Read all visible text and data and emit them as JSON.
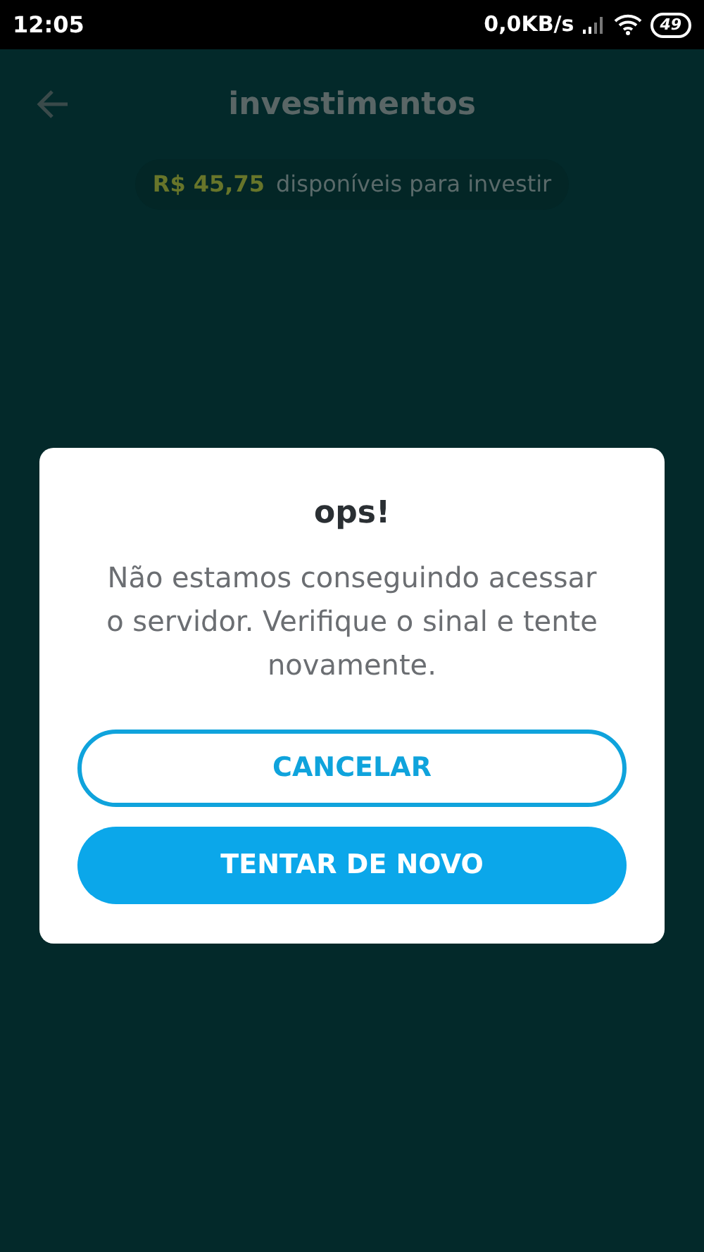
{
  "status_bar": {
    "time": "12:05",
    "speed": "0,0KB/s",
    "battery": "49"
  },
  "header": {
    "title": "investimentos"
  },
  "balance": {
    "amount": "R$ 45,75",
    "label": "disponíveis para investir"
  },
  "dialog": {
    "title": "ops!",
    "message": "Não estamos conseguindo acessar o servidor. Verifique o sinal e tente novamente.",
    "buttons": [
      {
        "label": "CANCELAR",
        "kind": "outline"
      },
      {
        "label": "TENTAR DE NOVO",
        "kind": "filled"
      }
    ]
  }
}
